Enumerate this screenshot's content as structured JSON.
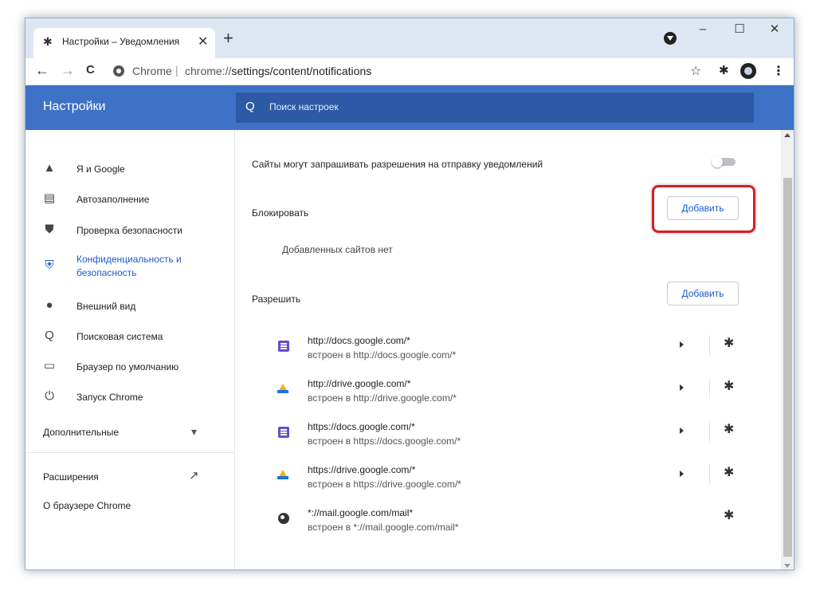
{
  "tab": {
    "title": "Настройки – Уведомления",
    "close": "✕",
    "new_tab": "+"
  },
  "window": {
    "minimize": "–",
    "maximize": "☐",
    "close": "✕"
  },
  "toolbar": {
    "back": "←",
    "forward": "→",
    "reload": "C",
    "site_label": "Chrome",
    "separator": "|",
    "url_scheme": "chrome://",
    "url_path": "settings/content/notifications",
    "star": "☆",
    "extensions": "✱",
    "menu": "⋮"
  },
  "header": {
    "title": "Настройки",
    "search_icon": "Q",
    "search_placeholder": "Поиск настроек"
  },
  "sidebar": {
    "items": [
      {
        "label": "Я и Google",
        "icon": "person-icon",
        "glyph": "▲"
      },
      {
        "label": "Автозаполнение",
        "icon": "clipboard-icon",
        "glyph": "▤"
      },
      {
        "label": "Проверка безопасности",
        "icon": "shield-check-icon",
        "glyph": "⛊"
      },
      {
        "label": "Конфиденциальность и\nбезопасность",
        "icon": "shield-icon",
        "glyph": "⛨"
      },
      {
        "label": "Внешний вид",
        "icon": "palette-icon",
        "glyph": "●"
      },
      {
        "label": "Поисковая система",
        "icon": "search-icon",
        "glyph": "Q"
      },
      {
        "label": "Браузер по умолчанию",
        "icon": "browser-icon",
        "glyph": "▭"
      },
      {
        "label": "Запуск Chrome",
        "icon": "power-icon",
        "glyph": "⏻"
      }
    ],
    "advanced": "Дополнительные",
    "advanced_arrow": "▾",
    "extensions": "Расширения",
    "extensions_icon": "↗",
    "about": "О браузере Chrome"
  },
  "main": {
    "ask_text": "Сайты могут запрашивать разрешения на отправку уведомлений",
    "ask_toggle_on": false,
    "block_title": "Блокировать",
    "block_add": "Добавить",
    "block_empty": "Добавленных сайтов нет",
    "allow_title": "Разрешить",
    "allow_add": "Добавить",
    "sites": [
      {
        "url": "http://docs.google.com/*",
        "sub": "встроен в http://docs.google.com/*",
        "icon": "docs-icon",
        "has_arrow": true
      },
      {
        "url": "http://drive.google.com/*",
        "sub": "встроен в http://drive.google.com/*",
        "icon": "drive-icon",
        "has_arrow": true
      },
      {
        "url": "https://docs.google.com/*",
        "sub": "встроен в https://docs.google.com/*",
        "icon": "docs-icon",
        "has_arrow": true
      },
      {
        "url": "https://drive.google.com/*",
        "sub": "встроен в https://drive.google.com/*",
        "icon": "drive-icon",
        "has_arrow": true
      },
      {
        "url": "*://mail.google.com/mail*",
        "sub": "встроен в *://mail.google.com/mail*",
        "icon": "globe-icon",
        "has_arrow": false
      }
    ],
    "puzzle_glyph": "✱"
  },
  "colors": {
    "header": "#3e72c6",
    "accent": "#1a5bd0",
    "highlight": "#d42020"
  }
}
